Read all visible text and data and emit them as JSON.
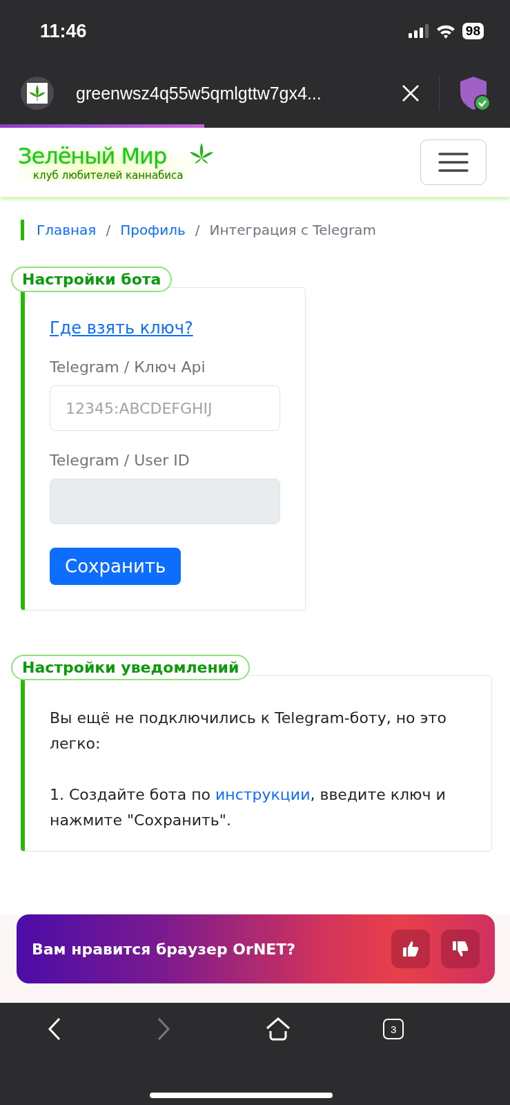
{
  "status_bar": {
    "time": "11:46",
    "battery": "98"
  },
  "address_bar": {
    "url": "greenwsz4q55w5qmlgttw7gx4...",
    "load_progress": {
      "level": 0.4
    }
  },
  "site_header": {
    "logo_title": "Зелёный Мир",
    "logo_subtitle": "клуб любителей каннабиса"
  },
  "breadcrumb": [
    {
      "label": "Главная",
      "kind": "link",
      "separator": "/"
    },
    {
      "label": "Профиль",
      "kind": "link",
      "separator": "/"
    },
    {
      "label": "Интеграция с Telegram",
      "kind": "current"
    }
  ],
  "bot_settings": {
    "title": "Настройки бота",
    "help_link": "Где взять ключ?",
    "fields": [
      {
        "label": "Telegram / Ключ Api",
        "placeholder": "12345:ABCDEFGHIJ",
        "disabled": false
      },
      {
        "label": "Telegram / User ID",
        "disabled": true
      }
    ],
    "save_button": "Сохранить"
  },
  "notification_settings": {
    "title": "Настройки уведомлений",
    "intro": "Вы ещё не подключились к Telegram-боту, но это легко:",
    "step": {
      "before": "1. Создайте бота по ",
      "link": "инструкции",
      "after": ", введите ключ и нажмите \"Сохранить\"."
    }
  },
  "rating_prompt": {
    "question": "Вам нравится браузер OrNET?"
  },
  "bottom_toolbar": {
    "buttons": [
      {
        "kind": "back",
        "disabled": false
      },
      {
        "kind": "forward",
        "disabled": true
      },
      {
        "kind": "home",
        "disabled": false
      },
      {
        "kind": "tabs",
        "label": "3",
        "disabled": false
      }
    ]
  }
}
